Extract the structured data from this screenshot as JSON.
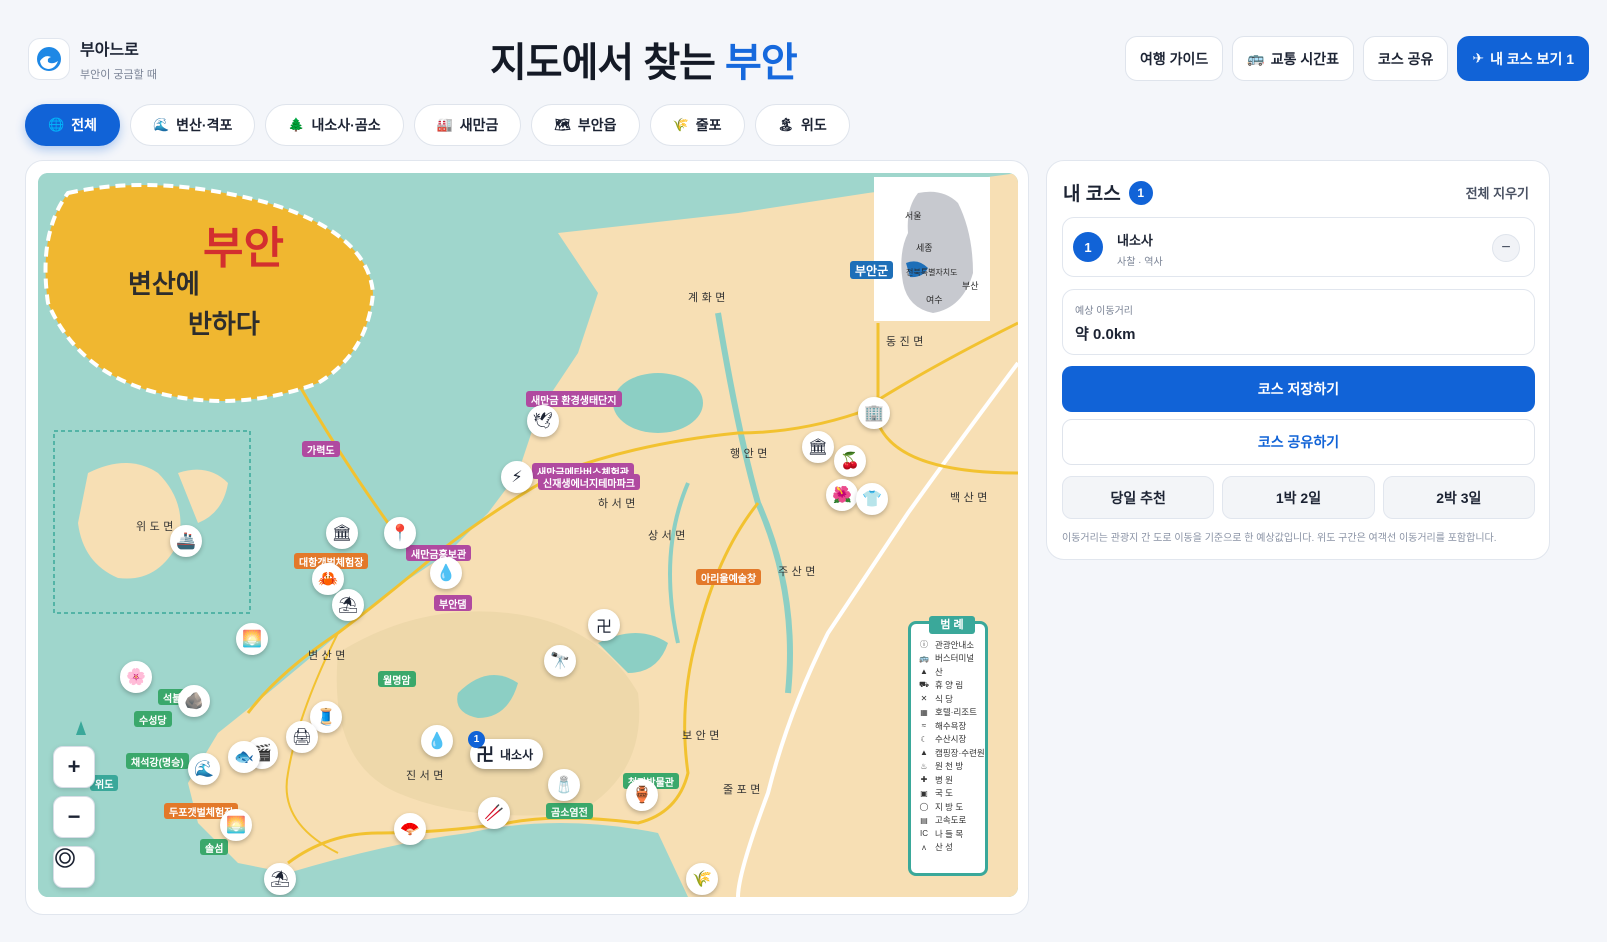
{
  "brand": {
    "name": "부아느로",
    "subtitle": "부안이 궁금할 때",
    "logo_icon": "wave-icon"
  },
  "title": {
    "prefix": "지도에서 찾는",
    "accent": "부안",
    "accent_color": "#1669dd"
  },
  "top_actions": [
    {
      "label": "여행 가이드",
      "icon": ""
    },
    {
      "label": "교통 시간표",
      "icon": "bus-icon"
    },
    {
      "label": "코스 공유",
      "icon": ""
    },
    {
      "label": "내 코스 보기 1",
      "icon": "airplane-icon",
      "primary": true
    }
  ],
  "tabs": [
    {
      "label": "전체",
      "icon": "globe-icon",
      "active": true
    },
    {
      "label": "변산·격포",
      "icon": "wave-icon"
    },
    {
      "label": "내소사·곰소",
      "icon": "tree-icon"
    },
    {
      "label": "새만금",
      "icon": "building-icon"
    },
    {
      "label": "부안읍",
      "icon": "map-icon"
    },
    {
      "label": "줄포",
      "icon": "reed-icon"
    },
    {
      "label": "위도",
      "icon": "island-icon"
    }
  ],
  "map": {
    "banner_title": "부안",
    "banner_sub": "변산에 반하다",
    "inset_labels": [
      "서울",
      "세종",
      "부안군",
      "전북특별자치도",
      "여수",
      "부산"
    ],
    "region_labels": [
      "계 화 면",
      "동 진 면",
      "행 안 면",
      "하 서 면",
      "상 서 면",
      "주 산 면",
      "변 산 면",
      "진 서 면",
      "보 안 면",
      "줄 포 면",
      "백 산 면",
      "위 도 면"
    ],
    "poi_badges": [
      {
        "label": "새만금 환경생태단지",
        "color": "#b04aa0"
      },
      {
        "label": "새만금메타버스체험관",
        "color": "#b04aa0"
      },
      {
        "label": "신재생에너지테마파크",
        "color": "#b04aa0"
      },
      {
        "label": "새만금홍보관",
        "color": "#b04aa0"
      },
      {
        "label": "가력도",
        "color": "#b04aa0"
      },
      {
        "label": "대항갯벌체험장",
        "color": "#e3792a"
      },
      {
        "label": "부안댐",
        "color": "#b04aa0"
      },
      {
        "label": "청자박물관",
        "color": "#3aa86b"
      },
      {
        "label": "곰소염전",
        "color": "#3aa86b"
      },
      {
        "label": "아리울예술창",
        "color": "#e3792a"
      },
      {
        "label": "월명암",
        "color": "#3aa86b"
      },
      {
        "label": "수성당",
        "color": "#3aa86b"
      },
      {
        "label": "채석강(명승)",
        "color": "#3aa86b"
      },
      {
        "label": "두포갯벌체험장",
        "color": "#e3792a"
      },
      {
        "label": "솔섬",
        "color": "#3aa86b"
      },
      {
        "label": "위도",
        "color": "#3aa89a"
      },
      {
        "label": "석불산",
        "color": "#3aa86b"
      },
      {
        "label": "부안군",
        "color": "#1e6fb8"
      }
    ],
    "selected_poi": {
      "number": "1",
      "label": "내소사"
    },
    "legend": {
      "title": "범 례",
      "items": [
        {
          "sym": "ⓘ",
          "label": "관광안내소"
        },
        {
          "sym": "🚌",
          "label": "버스터미널"
        },
        {
          "sym": "▲",
          "label": "산"
        },
        {
          "sym": "⛟",
          "label": "휴 양 림"
        },
        {
          "sym": "✕",
          "label": "식 당"
        },
        {
          "sym": "▦",
          "label": "호텔·리조트"
        },
        {
          "sym": "≈",
          "label": "해수욕장"
        },
        {
          "sym": "☾",
          "label": "수산시장"
        },
        {
          "sym": "▲",
          "label": "캠핑장·수련원"
        },
        {
          "sym": "♨",
          "label": "원 천 방"
        },
        {
          "sym": "✚",
          "label": "병 원"
        },
        {
          "sym": "▣",
          "label": "국 도"
        },
        {
          "sym": "◯",
          "label": "지 방 도"
        },
        {
          "sym": "▤",
          "label": "고속도로"
        },
        {
          "sym": "IC",
          "label": "나 들 목"
        },
        {
          "sym": "ᴧ",
          "label": "산 성"
        }
      ]
    },
    "zoom_in": "+",
    "zoom_out": "−",
    "locate_icon": "target-icon"
  },
  "course": {
    "title": "내 코스",
    "count": "1",
    "clear_label": "전체 지우기",
    "items": [
      {
        "number": "1",
        "name": "내소사",
        "category": "사찰 · 역사",
        "remove": "−"
      }
    ],
    "distance_label": "예상 이동거리",
    "distance_value": "약 0.0km",
    "save_label": "코스 저장하기",
    "share_label": "코스 공유하기",
    "plans": [
      "당일 추천",
      "1박 2일",
      "2박 3일"
    ],
    "note": "이동거리는 관광지 간 도로 이동을 기준으로 한 예상값입니다. 위도 구간은 여객선 이동거리를 포함합니다."
  }
}
